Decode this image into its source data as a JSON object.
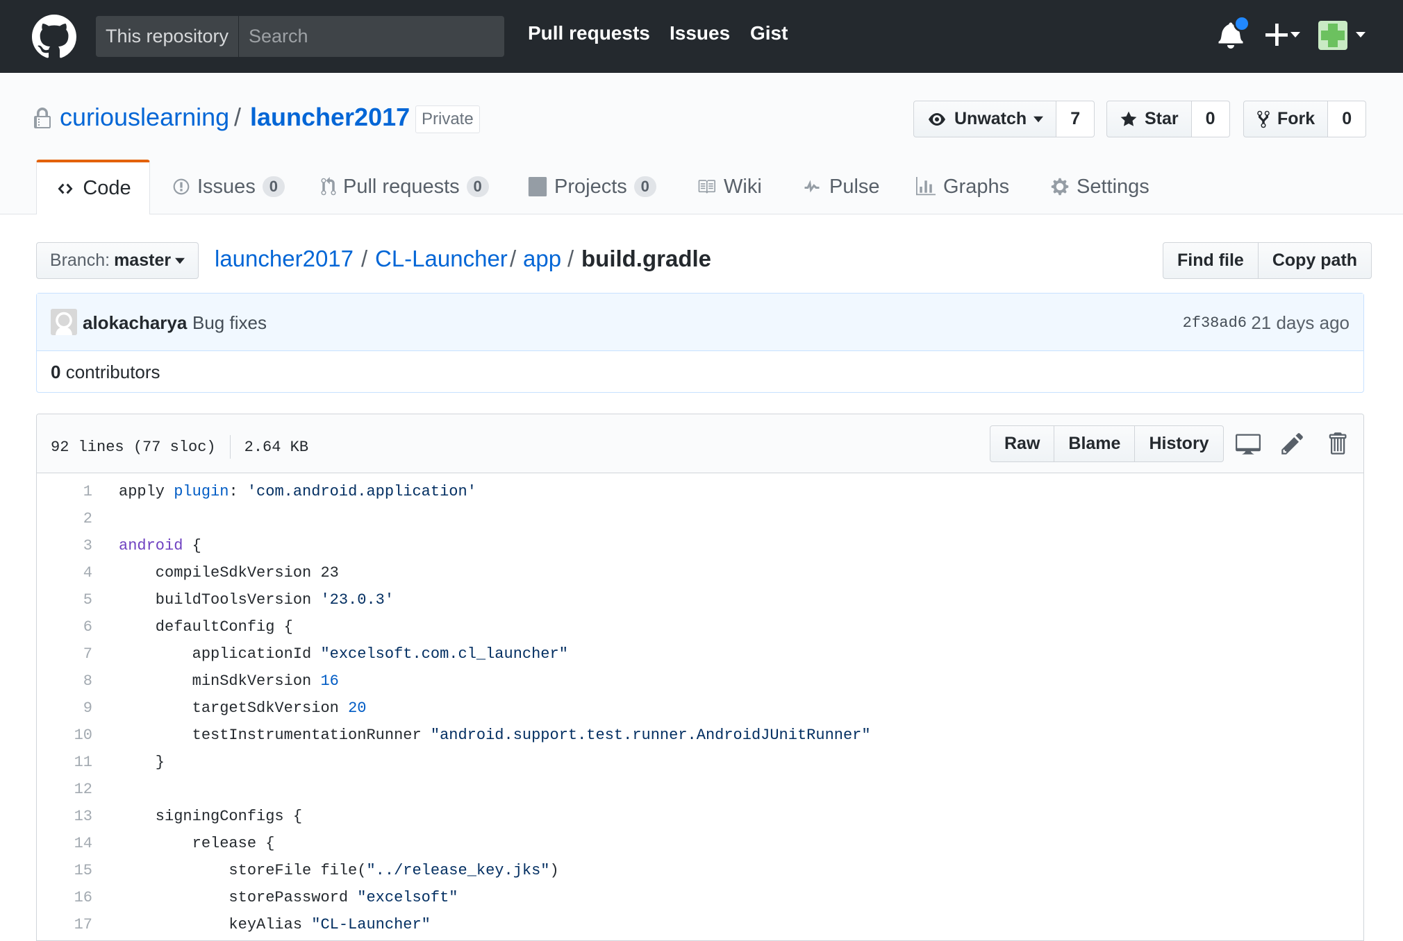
{
  "header": {
    "search_scope": "This repository",
    "search_placeholder": "Search",
    "nav": [
      "Pull requests",
      "Issues",
      "Gist"
    ],
    "icons": [
      "github-logo-icon",
      "bell-icon",
      "plus-icon",
      "avatar-icon"
    ]
  },
  "repo": {
    "owner": "curiouslearning",
    "separator": "/",
    "name": "launcher2017",
    "visibility": "Private",
    "watch": {
      "label": "Unwatch",
      "count": "7"
    },
    "star": {
      "label": "Star",
      "count": "0"
    },
    "fork": {
      "label": "Fork",
      "count": "0"
    }
  },
  "tabs": [
    {
      "label": "Code"
    },
    {
      "label": "Issues",
      "count": "0"
    },
    {
      "label": "Pull requests",
      "count": "0"
    },
    {
      "label": "Projects",
      "count": "0"
    },
    {
      "label": "Wiki"
    },
    {
      "label": "Pulse"
    },
    {
      "label": "Graphs"
    },
    {
      "label": "Settings"
    }
  ],
  "filenav": {
    "branch_label": "Branch:",
    "branch_name": "master",
    "path": [
      "launcher2017",
      "CL-Launcher",
      "app"
    ],
    "file": "build.gradle",
    "find_file": "Find file",
    "copy_path": "Copy path"
  },
  "commit": {
    "author": "alokacharya",
    "message": "Bug fixes",
    "sha": "2f38ad6",
    "time": "21 days ago",
    "contributors_count": "0",
    "contributors_label": "contributors"
  },
  "file": {
    "lines": "92 lines (77 sloc)",
    "size": "2.64 KB",
    "buttons": [
      "Raw",
      "Blame",
      "History"
    ],
    "icons": [
      "desktop-icon",
      "pencil-icon",
      "trash-icon"
    ]
  },
  "code": [
    {
      "n": "1",
      "t": [
        [
          "apply ",
          ""
        ],
        [
          "plugin",
          "fn"
        ],
        [
          ": ",
          ""
        ],
        [
          "'com.android.application'",
          "str"
        ]
      ]
    },
    {
      "n": "2",
      "t": []
    },
    {
      "n": "3",
      "t": [
        [
          "android",
          "kw"
        ],
        [
          " {",
          ""
        ]
      ]
    },
    {
      "n": "4",
      "t": [
        [
          "    compileSdkVersion 23",
          ""
        ]
      ]
    },
    {
      "n": "5",
      "t": [
        [
          "    buildToolsVersion ",
          ""
        ],
        [
          "'23.0.3'",
          "str"
        ]
      ]
    },
    {
      "n": "6",
      "t": [
        [
          "    defaultConfig {",
          ""
        ]
      ]
    },
    {
      "n": "7",
      "t": [
        [
          "        applicationId ",
          ""
        ],
        [
          "\"excelsoft.com.cl_launcher\"",
          "str"
        ]
      ]
    },
    {
      "n": "8",
      "t": [
        [
          "        minSdkVersion ",
          ""
        ],
        [
          "16",
          "num"
        ]
      ]
    },
    {
      "n": "9",
      "t": [
        [
          "        targetSdkVersion ",
          ""
        ],
        [
          "20",
          "num"
        ]
      ]
    },
    {
      "n": "10",
      "t": [
        [
          "        testInstrumentationRunner ",
          ""
        ],
        [
          "\"android.support.test.runner.AndroidJUnitRunner\"",
          "str"
        ]
      ]
    },
    {
      "n": "11",
      "t": [
        [
          "    }",
          ""
        ]
      ]
    },
    {
      "n": "12",
      "t": []
    },
    {
      "n": "13",
      "t": [
        [
          "    signingConfigs {",
          ""
        ]
      ]
    },
    {
      "n": "14",
      "t": [
        [
          "        release {",
          ""
        ]
      ]
    },
    {
      "n": "15",
      "t": [
        [
          "            storeFile file(",
          ""
        ],
        [
          "\"../release_key.jks\"",
          "str"
        ],
        [
          ")",
          ""
        ]
      ]
    },
    {
      "n": "16",
      "t": [
        [
          "            storePassword ",
          ""
        ],
        [
          "\"excelsoft\"",
          "str"
        ]
      ]
    },
    {
      "n": "17",
      "t": [
        [
          "            keyAlias ",
          ""
        ],
        [
          "\"CL-Launcher\"",
          "str"
        ]
      ]
    }
  ],
  "colors": {
    "header_bg": "#24292e",
    "link": "#0366d6",
    "active_tab_accent": "#e36209",
    "commit_bg": "#f1f8ff",
    "notification_dot": "#2188ff"
  }
}
